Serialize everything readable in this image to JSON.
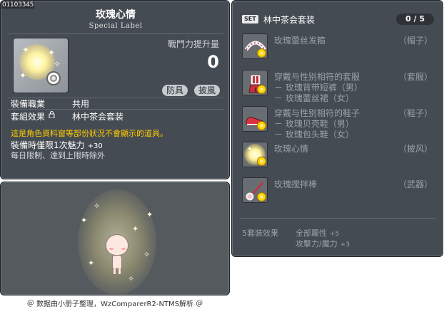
{
  "item": {
    "id": "01103345",
    "name": "玫瑰心情",
    "label": "Special Label",
    "power_label": "戰鬥力提升量",
    "power_value": "0",
    "tags": [
      "防具",
      "披風"
    ],
    "job_label": "裝備職業",
    "job_value": "共用",
    "set_label": "套組效果",
    "set_value": "林中茶会套装",
    "notice": "這是角色資料窗等部份狀況不會顯示的道具。",
    "equip_bonus": "裝備時僅限1次魅力",
    "equip_bonus_value": "+30",
    "limit": "每日限制、達到上限時除外"
  },
  "footer": "＠ 数据由小册子整理，WzComparerR2-NTMS解析 ＠",
  "set": {
    "badge": "SET",
    "title": "林中茶会套装",
    "count": "0 / 5",
    "parts": [
      {
        "name": "玫瑰蕾丝发箍",
        "type": "（帽子）",
        "sub": []
      },
      {
        "name": "穿戴与性别相符的套服",
        "type": "（套服）",
        "sub": [
          "－ 玫瑰背带短裤（男）",
          "－ 玫瑰蕾丝裙（女）"
        ]
      },
      {
        "name": "穿戴与性别相符的鞋子",
        "type": "（鞋子）",
        "sub": [
          "－ 玫瑰贝壳鞋（男）",
          "－ 玫瑰包头鞋（女）"
        ]
      },
      {
        "name": "玫瑰心情",
        "type": "（披风）",
        "sub": []
      },
      {
        "name": "玫瑰搅拌棒",
        "type": "（武器）",
        "sub": []
      }
    ],
    "effect_label": "5套装效果",
    "effects": [
      {
        "text": "全部屬性",
        "value": "+5"
      },
      {
        "text": "攻擊力/魔力",
        "value": "+3"
      }
    ]
  },
  "colors": {
    "panel_bg": "#454b52",
    "notice": "#ffcc00",
    "inactive_text": "#9ba1a8"
  }
}
